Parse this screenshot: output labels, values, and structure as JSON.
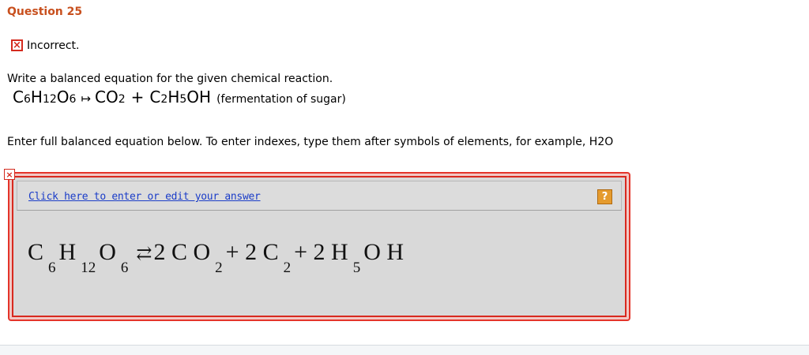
{
  "question": {
    "title": "Question 25"
  },
  "status": {
    "icon": "x-icon",
    "mark": "×",
    "text": "Incorrect.",
    "color": "#d42a1e"
  },
  "prompt": "Write a balanced equation for the given chemical reaction.",
  "reaction": {
    "reactant": {
      "c": "C",
      "c_sub": "6",
      "h": "H",
      "h_sub": "12",
      "o": "O",
      "o_sub": "6"
    },
    "arrow": "↦",
    "product1": {
      "c": "CO",
      "sub": "2"
    },
    "plus": "+",
    "product2": {
      "c": "C",
      "c_sub": "2",
      "h": "H",
      "h_sub": "5",
      "oh": "OH"
    },
    "note": "(fermentation of sugar)"
  },
  "instructions": "Enter full balanced equation below. To enter indexes, type them after symbols of elements, for example, H2O",
  "answer_box": {
    "error_mark": "×",
    "edit_link": "Click here to enter or edit your answer",
    "help_icon": "?",
    "equation": {
      "t1": "C",
      "s1": "6",
      "t2": "H",
      "s2": "12",
      "t3": "O",
      "s3": "6",
      "arrow": "⇄",
      "t4": "2 C O",
      "s4": "2",
      "t5": "+ 2 C",
      "s5": "2",
      "t6": "+ 2 H",
      "s6": "5",
      "t7": "O H"
    }
  },
  "colors": {
    "title": "#c8501e",
    "error": "#d42a1e",
    "link": "#1a3cc8",
    "help": "#e59b2e"
  }
}
